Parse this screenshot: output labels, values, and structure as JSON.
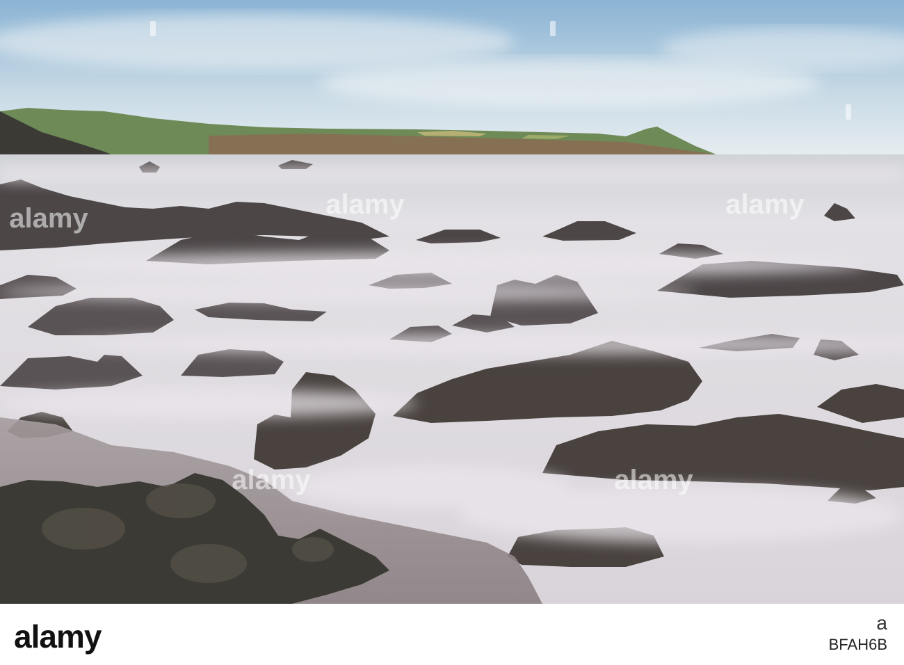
{
  "scene": {
    "description_tags": [
      "sea",
      "fog",
      "rocks",
      "coastline",
      "headland"
    ],
    "colors": {
      "sky_top": "#8fb7d6",
      "sky_bottom": "#e6eef2",
      "mist": "#e8e4ea",
      "rock_dark": "#3f3a3c",
      "rock_mid": "#5b5557",
      "headland_green": "#6f8b58",
      "headland_brown": "#8a6a4e"
    }
  },
  "watermark": {
    "text": "alamy"
  },
  "footer": {
    "logo": "alamy",
    "prefix": "a",
    "image_id": "BFAH6B"
  }
}
